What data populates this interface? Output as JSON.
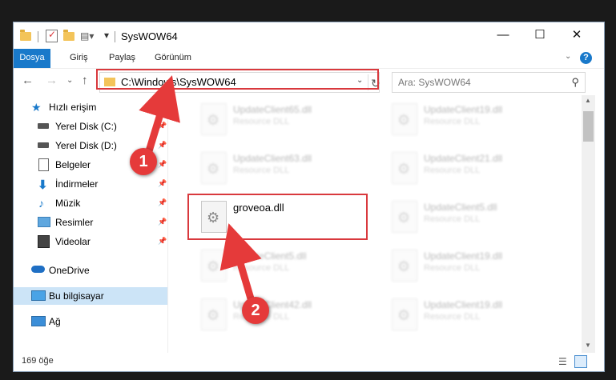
{
  "window": {
    "title": "SysWOW64",
    "minimize_glyph": "—",
    "maximize_glyph": "☐",
    "close_glyph": "✕"
  },
  "ribbon": {
    "tabs": [
      "Dosya",
      "Giriş",
      "Paylaş",
      "Görünüm"
    ],
    "help_glyph": "?"
  },
  "address": {
    "path": "C:\\Windows\\SysWOW64",
    "search_placeholder": "Ara: SysWOW64"
  },
  "sidebar": {
    "items": [
      {
        "label": "Hızlı erişim",
        "icon": "star-icon",
        "pinned": false
      },
      {
        "label": "Yerel Disk (C:)",
        "icon": "drive-icon",
        "pinned": true
      },
      {
        "label": "Yerel Disk (D:)",
        "icon": "drive-icon",
        "pinned": true
      },
      {
        "label": "Belgeler",
        "icon": "documents-icon",
        "pinned": true
      },
      {
        "label": "İndirmeler",
        "icon": "download-icon",
        "pinned": true
      },
      {
        "label": "Müzik",
        "icon": "music-icon",
        "pinned": true
      },
      {
        "label": "Resimler",
        "icon": "pictures-icon",
        "pinned": true
      },
      {
        "label": "Videolar",
        "icon": "video-icon",
        "pinned": true
      },
      {
        "label": "OneDrive",
        "icon": "cloud-icon",
        "pinned": false
      },
      {
        "label": "Bu bilgisayar",
        "icon": "computer-icon",
        "pinned": false,
        "selected": true
      },
      {
        "label": "Ağ",
        "icon": "network-icon",
        "pinned": false
      }
    ]
  },
  "files": {
    "left": [
      {
        "name": "UpdateClient65.dll",
        "type": "Resource DLL"
      },
      {
        "name": "UpdateClient63.dll",
        "type": "Resource DLL"
      },
      {
        "name": "groveoa.dll",
        "type": "",
        "highlighted": true
      },
      {
        "name": "UpdateClient5.dll",
        "type": "Resource DLL"
      },
      {
        "name": "UpdateClient42.dll",
        "type": "Resource DLL"
      }
    ],
    "right": [
      {
        "name": "UpdateClient19.dll",
        "type": "Resource DLL"
      },
      {
        "name": "UpdateClient21.dll",
        "type": "Resource DLL"
      },
      {
        "name": "UpdateClient5.dll",
        "type": "Resource DLL"
      },
      {
        "name": "UpdateClient19.dll",
        "type": "Resource DLL"
      },
      {
        "name": "UpdateClient19.dll",
        "type": "Resource DLL"
      }
    ]
  },
  "status": {
    "count": "169 öğe"
  },
  "annotations": {
    "step1": "1",
    "step2": "2"
  },
  "colors": {
    "accent": "#1979ca",
    "highlight": "#d9393d",
    "badge": "#e53a3a"
  }
}
